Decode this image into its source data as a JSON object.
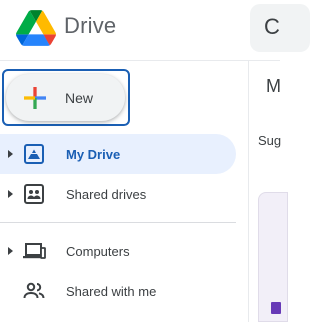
{
  "app": {
    "name": "Drive",
    "logo_icon": "google-drive-logo-icon"
  },
  "search": {
    "icon": "search-icon",
    "partial_text": "C"
  },
  "new_button": {
    "label": "New",
    "icon": "plus-icon"
  },
  "sidebar": {
    "items": [
      {
        "label": "My Drive",
        "icon": "my-drive-icon",
        "active": true,
        "expandable": true
      },
      {
        "label": "Shared drives",
        "icon": "shared-drives-icon",
        "active": false,
        "expandable": true
      },
      {
        "label": "Computers",
        "icon": "computers-icon",
        "active": false,
        "expandable": true
      },
      {
        "label": "Shared with me",
        "icon": "shared-with-me-icon",
        "active": false,
        "expandable": false
      }
    ]
  },
  "main": {
    "heading_partial": "M",
    "section_partial": "Sug"
  },
  "colors": {
    "accent": "#1a5fb4",
    "active_bg": "#e8f0fe",
    "new_bg": "#f1f3f4",
    "plus_blue": "#4285f4",
    "plus_red": "#ea4335",
    "plus_yellow": "#fbbc04",
    "plus_green": "#34a853",
    "doc_icon": "#673ab7"
  }
}
